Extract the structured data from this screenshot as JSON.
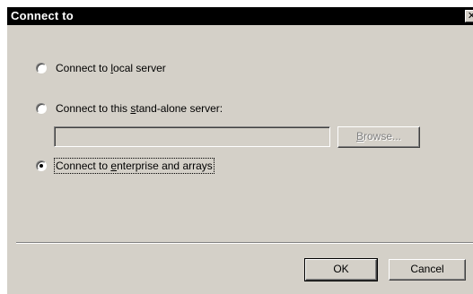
{
  "window": {
    "title": "Connect to",
    "close_glyph": "✕"
  },
  "options": {
    "local": {
      "prefix": "Connect to ",
      "accel": "l",
      "suffix": "ocal server",
      "checked": false
    },
    "standalone": {
      "prefix": "Connect to this ",
      "accel": "s",
      "suffix": "tand-alone server:",
      "checked": false
    },
    "enterprise": {
      "prefix": "Connect to ",
      "accel": "e",
      "suffix": "nterprise and arrays",
      "checked": true
    }
  },
  "server_field": {
    "value": "",
    "enabled": false
  },
  "buttons": {
    "browse": {
      "accel": "B",
      "rest": "rowse...",
      "enabled": false
    },
    "ok": "OK",
    "cancel": "Cancel"
  },
  "colors": {
    "face": "#d4d0c8",
    "titlebar": "#000000",
    "title_text": "#ffffff"
  }
}
